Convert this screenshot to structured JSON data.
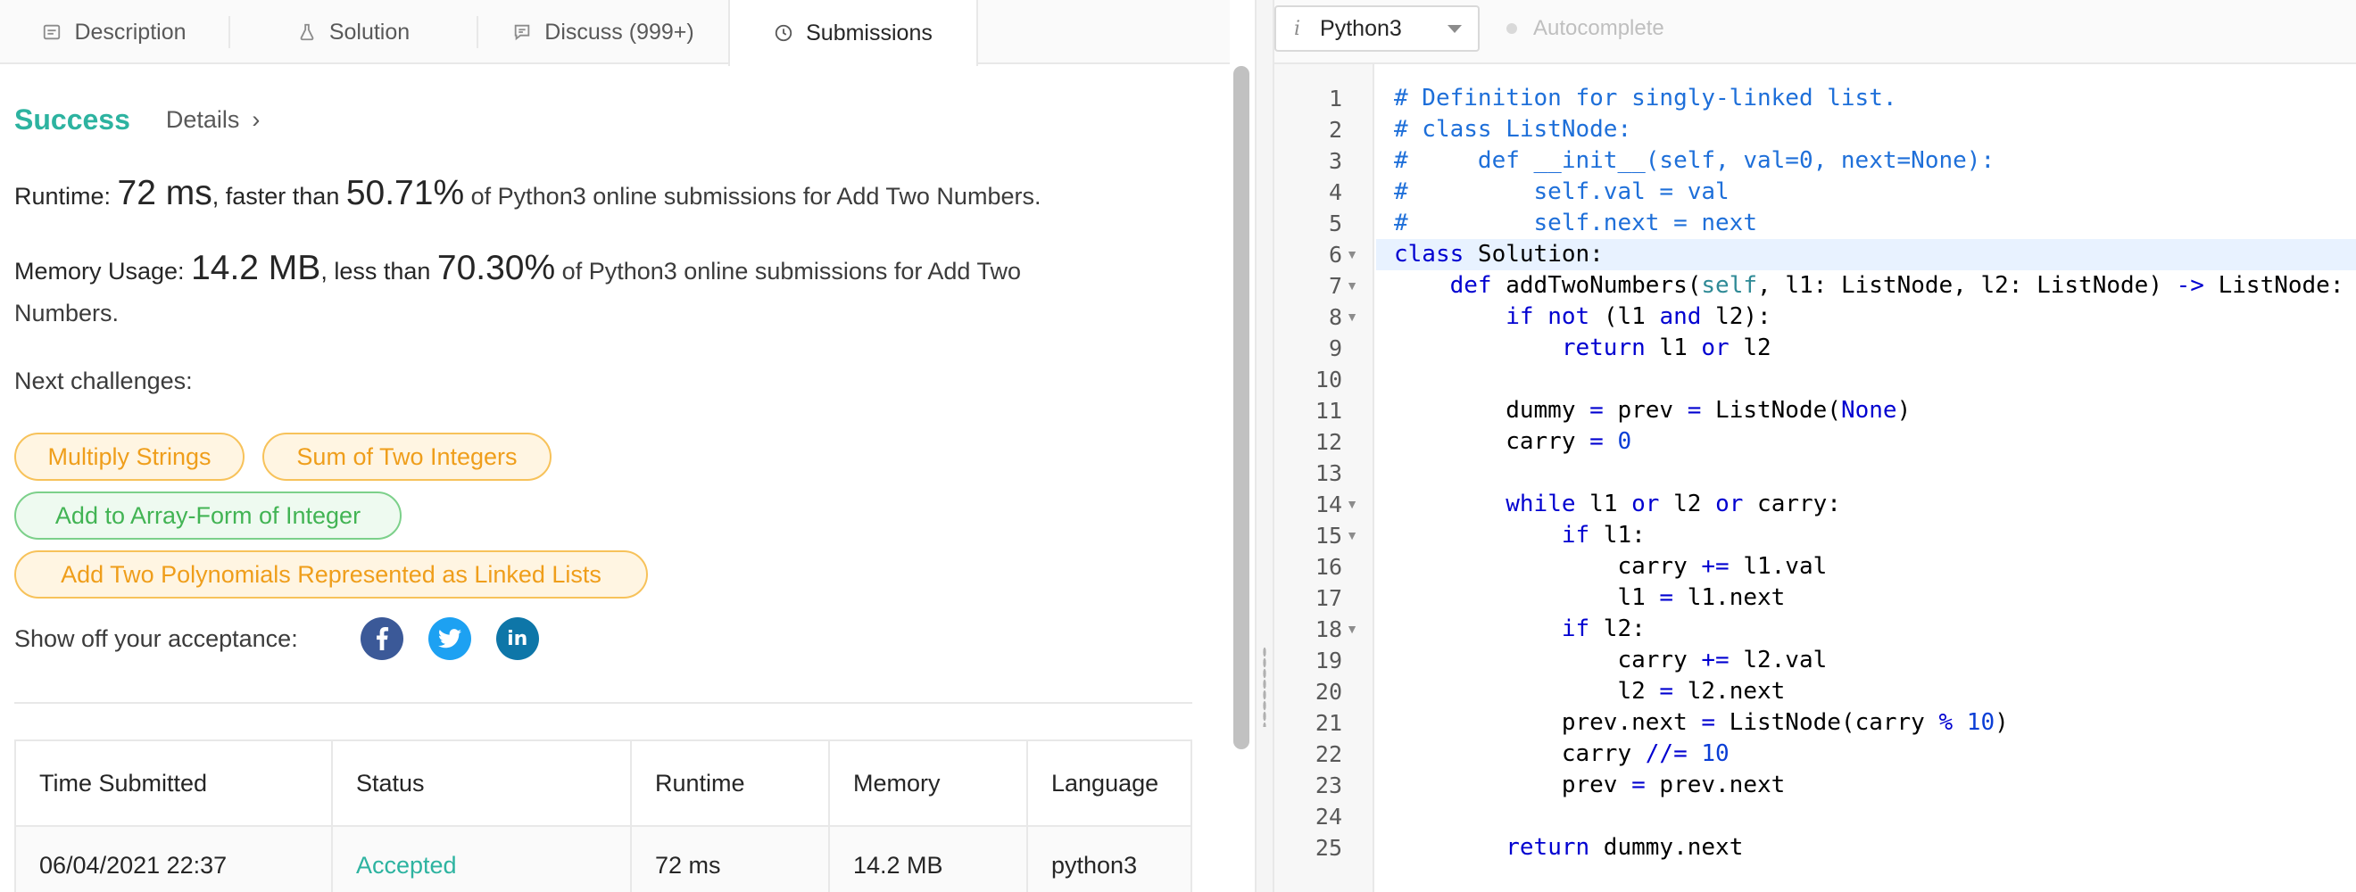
{
  "tabs": [
    {
      "label": "Description",
      "icon": "description-icon"
    },
    {
      "label": "Solution",
      "icon": "flask-icon"
    },
    {
      "label": "Discuss (999+)",
      "icon": "discuss-icon"
    },
    {
      "label": "Submissions",
      "icon": "clock-icon",
      "active": true
    }
  ],
  "result": {
    "status": "Success",
    "details_label": "Details",
    "runtime_prefix": "Runtime: ",
    "runtime_value": "72 ms",
    "runtime_mid": ", faster than ",
    "runtime_percent": "50.71%",
    "runtime_suffix": " of Python3 online submissions for Add Two Numbers.",
    "memory_prefix": "Memory Usage: ",
    "memory_value": "14.2 MB",
    "memory_mid": ", less than ",
    "memory_percent": "70.30%",
    "memory_suffix": " of Python3 online submissions for Add Two",
    "memory_suffix2": "Numbers."
  },
  "next_challenges": {
    "label": "Next challenges:",
    "items": [
      {
        "label": "Multiply Strings",
        "difficulty": "medium"
      },
      {
        "label": "Sum of Two Integers",
        "difficulty": "medium"
      },
      {
        "label": "Add to Array-Form of Integer",
        "difficulty": "easy"
      },
      {
        "label": "Add Two Polynomials Represented as Linked Lists",
        "difficulty": "medium"
      }
    ]
  },
  "share": {
    "label": "Show off your acceptance:",
    "linkedin_text": "in"
  },
  "submissions_table": {
    "headers": [
      "Time Submitted",
      "Status",
      "Runtime",
      "Memory",
      "Language"
    ],
    "rows": [
      [
        "06/04/2021 22:37",
        "Accepted",
        "72 ms",
        "14.2 MB",
        "python3"
      ]
    ]
  },
  "editor": {
    "language": "Python3",
    "info_glyph": "i",
    "autocomplete_label": "Autocomplete",
    "line_numbers": [
      "1",
      "2",
      "3",
      "4",
      "5",
      "6",
      "7",
      "8",
      "9",
      "10",
      "11",
      "12",
      "13",
      "14",
      "15",
      "16",
      "17",
      "18",
      "19",
      "20",
      "21",
      "22",
      "23",
      "24",
      "25"
    ],
    "fold_lines": [
      6,
      7,
      8,
      14,
      15,
      18
    ],
    "active_line": 6,
    "code_lines": [
      "# Definition for singly-linked list.",
      "# class ListNode:",
      "#     def __init__(self, val=0, next=None):",
      "#         self.val = val",
      "#         self.next = next",
      "class Solution:",
      "    def addTwoNumbers(self, l1: ListNode, l2: ListNode) -> ListNode:",
      "        if not (l1 and l2):",
      "            return l1 or l2",
      "",
      "        dummy = prev = ListNode(None)",
      "        carry = 0",
      "",
      "        while l1 or l2 or carry:",
      "            if l1:",
      "                carry += l1.val",
      "                l1 = l1.next",
      "            if l2:",
      "                carry += l2.val",
      "                l2 = l2.next",
      "            prev.next = ListNode(carry % 10)",
      "            carry //= 10",
      "            prev = prev.next",
      "",
      "        return dummy.next"
    ]
  },
  "colors": {
    "success": "#2db3a0",
    "medium_chip": "#ef9e1b",
    "easy_chip": "#42b454",
    "comment": "#1e6fd9",
    "keyword": "#0000d0"
  }
}
